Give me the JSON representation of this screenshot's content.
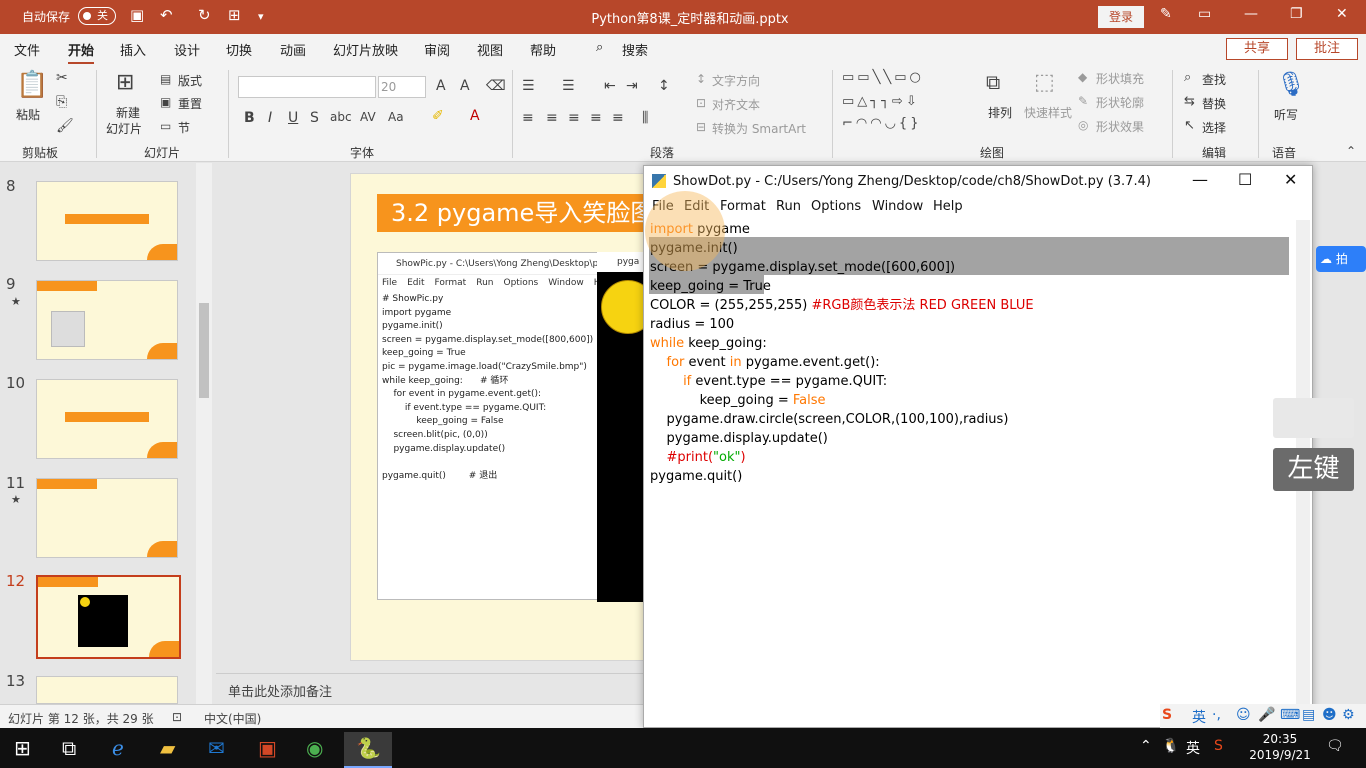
{
  "titlebar": {
    "autosave_label": "自动保存",
    "autosave_state": "关",
    "doc_title": "Python第8课_定时器和动画.pptx",
    "login_label": "登录"
  },
  "tabs": [
    "文件",
    "开始",
    "插入",
    "设计",
    "切换",
    "动画",
    "幻灯片放映",
    "审阅",
    "视图",
    "帮助"
  ],
  "active_tab": "开始",
  "search_label": "搜索",
  "share_label": "共享",
  "comment_label": "批注",
  "ribbon": {
    "paste": "粘贴",
    "new_slide_line1": "新建",
    "new_slide_line2": "幻灯片",
    "layout": "版式",
    "reset": "重置",
    "section": "节",
    "font_size": "20",
    "text_direction": "文字方向",
    "align_text": "对齐文本",
    "convert_smartart": "转换为 SmartArt",
    "arrange": "排列",
    "quick_styles": "快速样式",
    "shape_fill": "形状填充",
    "shape_outline": "形状轮廓",
    "shape_effects": "形状效果",
    "find": "查找",
    "replace": "替换",
    "select": "选择",
    "dictate": "听写",
    "groups": {
      "clipboard": "剪贴板",
      "slides": "幻灯片",
      "font": "字体",
      "paragraph": "段落",
      "drawing": "绘图",
      "editing": "编辑",
      "voice": "语音"
    }
  },
  "slides": [
    {
      "num": "8",
      "star": ""
    },
    {
      "num": "9",
      "star": "★"
    },
    {
      "num": "10",
      "star": ""
    },
    {
      "num": "11",
      "star": "★"
    },
    {
      "num": "12",
      "star": ""
    },
    {
      "num": "13",
      "star": ""
    }
  ],
  "slide": {
    "title": "3.2 pygame导入笑脸图",
    "showpic_title": "ShowPic.py - C:\\Users\\Yong Zheng\\Desktop\\py",
    "showpic_menu": [
      "File",
      "Edit",
      "Format",
      "Run",
      "Options",
      "Window",
      "He"
    ],
    "pygame_win_title": "pyga"
  },
  "notes_placeholder": "单击此处添加备注",
  "status": {
    "slide_info": "幻灯片 第 12 张，共 29 张",
    "language": "中文(中国)"
  },
  "idle": {
    "title": "ShowDot.py - C:/Users/Yong Zheng/Desktop/code/ch8/ShowDot.py (3.7.4)",
    "menu": [
      "File",
      "Edit",
      "Format",
      "Run",
      "Options",
      "Window",
      "Help"
    ]
  },
  "overlay": {
    "left_key": "左键",
    "cloud_label": "拍"
  },
  "ime": {
    "lang": "英"
  },
  "tray": {
    "lang": "英",
    "time": "20:35",
    "date": "2019/9/21"
  },
  "colors": {
    "accent": "#b7472a",
    "slide_orange": "#f7941d",
    "idle_keyword": "#ff7700",
    "idle_comment": "#dd0000",
    "idle_string": "#00aa00"
  }
}
